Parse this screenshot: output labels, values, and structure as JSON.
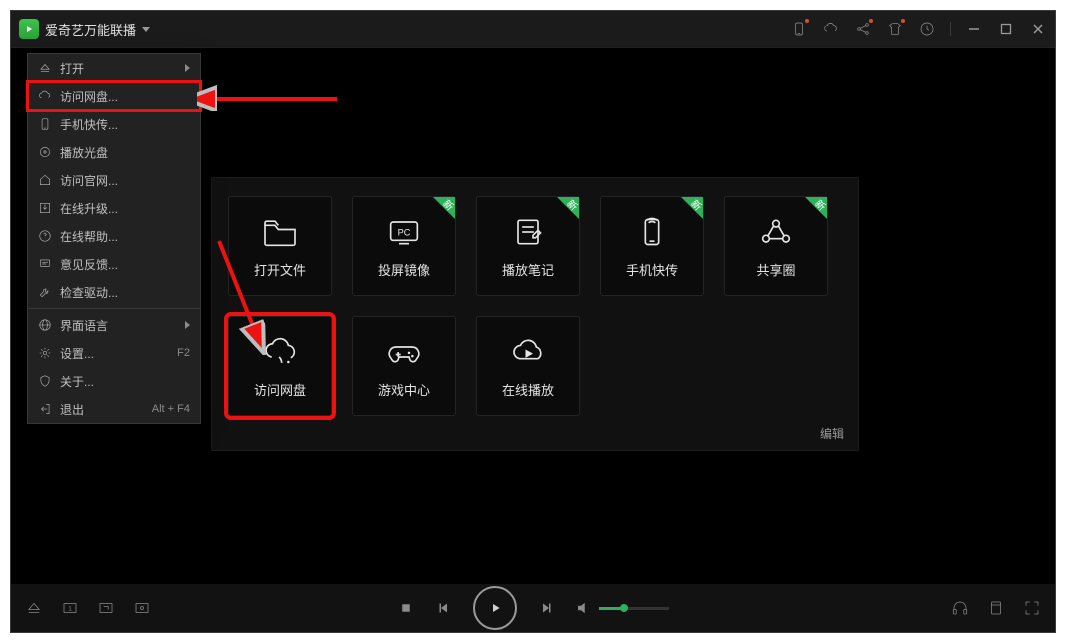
{
  "app": {
    "title": "爱奇艺万能联播"
  },
  "titlebar_icons": [
    "phone",
    "cloud",
    "share",
    "shirt",
    "history"
  ],
  "menu": {
    "items": [
      {
        "icon": "eject",
        "label": "打开",
        "arrow": true
      },
      {
        "icon": "cloud",
        "label": "访问网盘...",
        "highlight": true
      },
      {
        "icon": "phone",
        "label": "手机快传..."
      },
      {
        "icon": "disc",
        "label": "播放光盘"
      },
      {
        "icon": "home",
        "label": "访问官网..."
      },
      {
        "icon": "download",
        "label": "在线升级..."
      },
      {
        "icon": "help",
        "label": "在线帮助..."
      },
      {
        "icon": "feedback",
        "label": "意见反馈..."
      },
      {
        "icon": "wrench",
        "label": "检查驱动..."
      },
      {
        "sep": true
      },
      {
        "icon": "globe",
        "label": "界面语言",
        "arrow": true
      },
      {
        "icon": "gear",
        "label": "设置...",
        "accel": "F2"
      },
      {
        "icon": "shield",
        "label": "关于..."
      },
      {
        "icon": "exit",
        "label": "退出",
        "accel": "Alt + F4"
      }
    ]
  },
  "hero": {
    "tiles": [
      {
        "icon": "folder",
        "label": "打开文件"
      },
      {
        "icon": "pc",
        "label": "投屏镜像",
        "badge": "新"
      },
      {
        "icon": "note",
        "label": "播放笔记",
        "badge": "新"
      },
      {
        "icon": "phone",
        "label": "手机快传",
        "badge": "新"
      },
      {
        "icon": "share",
        "label": "共享圈",
        "badge": "新"
      },
      {
        "icon": "cloud",
        "label": "访问网盘",
        "highlight": true
      },
      {
        "icon": "gamepad",
        "label": "游戏中心"
      },
      {
        "icon": "playcloud",
        "label": "在线播放"
      }
    ],
    "edit_label": "编辑"
  },
  "player": {
    "volume_pct": 35
  }
}
